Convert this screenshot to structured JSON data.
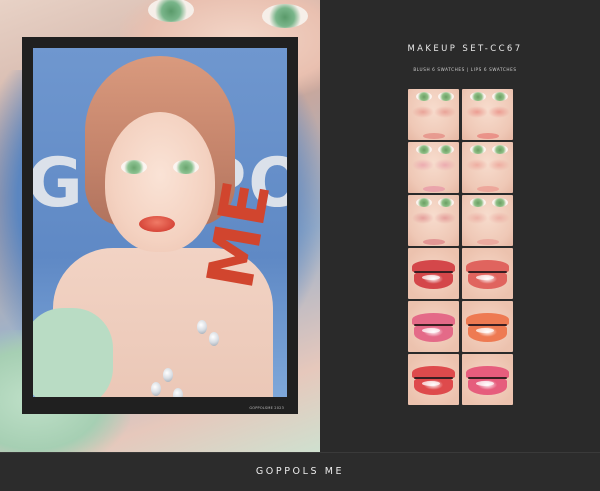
{
  "header": {
    "title": "MAKEUP SET-CC67",
    "subtitle": "BLUSH 6 SWATCHES | LIPS 6 SWATCHES"
  },
  "artwork": {
    "background_letters": "GOPPOLS",
    "accent_letters": "ME",
    "credit": "GOPPOLSME 2023"
  },
  "swatches": [
    {
      "type": "blush",
      "color": "#e58f86"
    },
    {
      "type": "blush",
      "color": "#e9857d"
    },
    {
      "type": "blush",
      "color": "#e99aa8"
    },
    {
      "type": "blush",
      "color": "#ec9d93"
    },
    {
      "type": "blush",
      "color": "#df8a8c"
    },
    {
      "type": "blush",
      "color": "#eaa39a"
    },
    {
      "type": "lips",
      "color": "#d4474a"
    },
    {
      "type": "lips",
      "color": "#e0645e"
    },
    {
      "type": "lips",
      "color": "#e46a88"
    },
    {
      "type": "lips",
      "color": "#ee7a52"
    },
    {
      "type": "lips",
      "color": "#de4a4c"
    },
    {
      "type": "lips",
      "color": "#e65d7d"
    }
  ],
  "footer": {
    "brand": "GOPPOLS ME"
  },
  "colors": {
    "panel_bg": "#2a2a2a",
    "frame": "#202020",
    "portrait_blue": "#5f89c5",
    "accent_red": "#d1452e"
  }
}
